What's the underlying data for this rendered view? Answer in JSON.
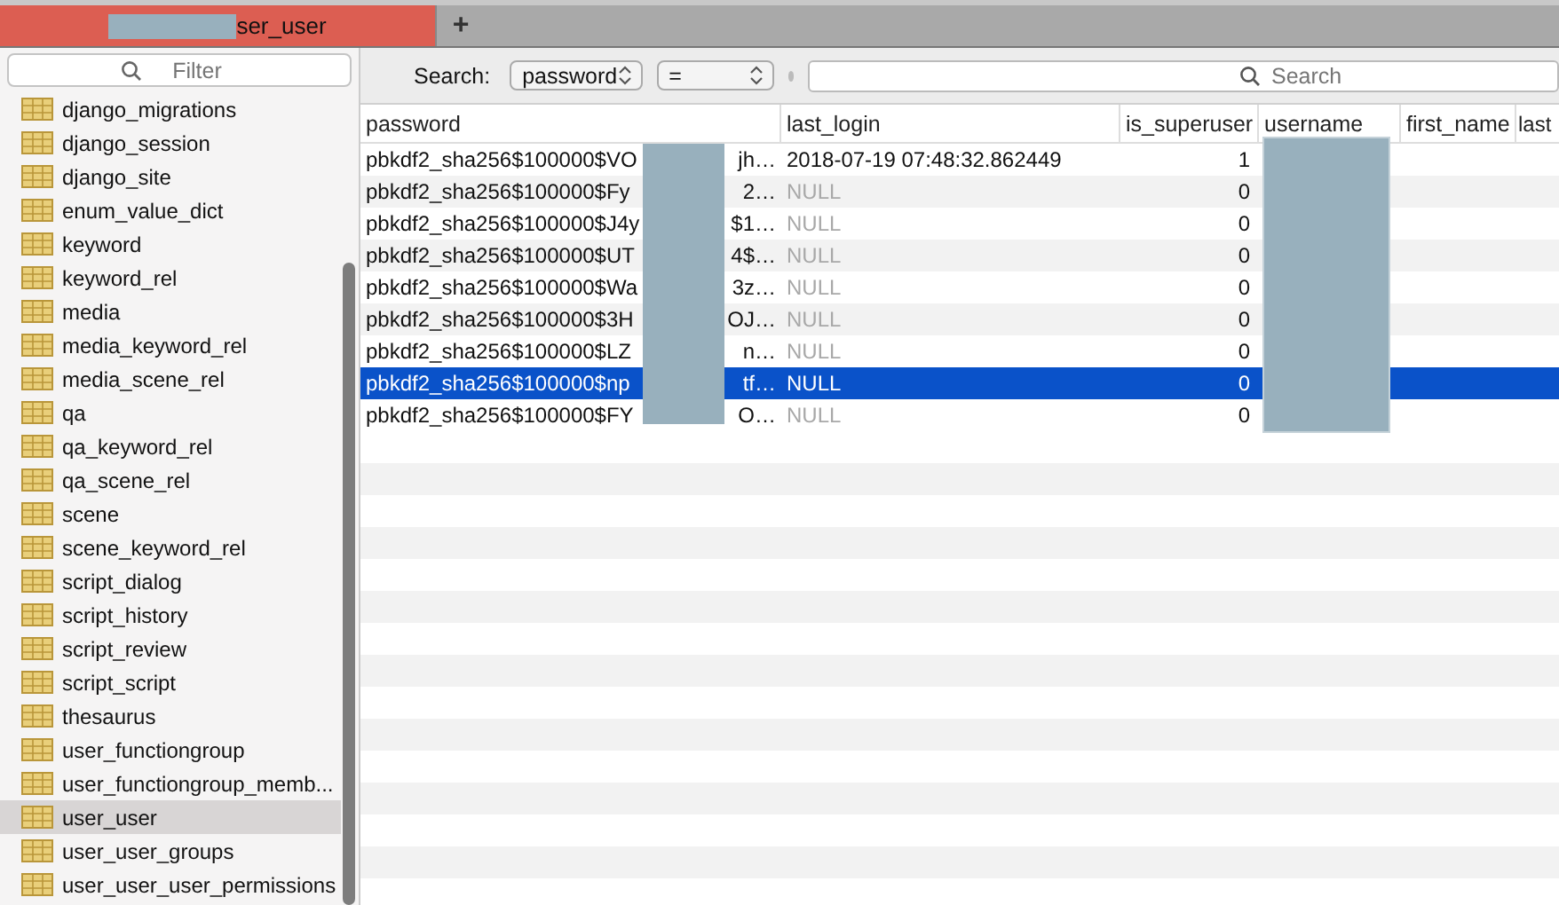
{
  "tabs": [
    {
      "title": "ser_user",
      "selected": true,
      "redacted": true
    }
  ],
  "new_tab_button": "+",
  "sidebar": {
    "filter_placeholder": "Filter",
    "items": [
      {
        "label": "django_migrations",
        "selected": false
      },
      {
        "label": "django_session",
        "selected": false
      },
      {
        "label": "django_site",
        "selected": false
      },
      {
        "label": "enum_value_dict",
        "selected": false
      },
      {
        "label": "keyword",
        "selected": false
      },
      {
        "label": "keyword_rel",
        "selected": false
      },
      {
        "label": "media",
        "selected": false
      },
      {
        "label": "media_keyword_rel",
        "selected": false
      },
      {
        "label": "media_scene_rel",
        "selected": false
      },
      {
        "label": "qa",
        "selected": false
      },
      {
        "label": "qa_keyword_rel",
        "selected": false
      },
      {
        "label": "qa_scene_rel",
        "selected": false
      },
      {
        "label": "scene",
        "selected": false
      },
      {
        "label": "scene_keyword_rel",
        "selected": false
      },
      {
        "label": "script_dialog",
        "selected": false
      },
      {
        "label": "script_history",
        "selected": false
      },
      {
        "label": "script_review",
        "selected": false
      },
      {
        "label": "script_script",
        "selected": false
      },
      {
        "label": "thesaurus",
        "selected": false
      },
      {
        "label": "user_functiongroup",
        "selected": false
      },
      {
        "label": "user_functiongroup_memb...",
        "selected": false
      },
      {
        "label": "user_user",
        "selected": true
      },
      {
        "label": "user_user_groups",
        "selected": false
      },
      {
        "label": "user_user_user_permissions",
        "selected": false
      }
    ]
  },
  "search_bar": {
    "label": "Search:",
    "field": "password",
    "operator": "=",
    "placeholder": "Search"
  },
  "table": {
    "columns": [
      "password",
      "last_login",
      "is_superuser",
      "username",
      "first_name",
      "last"
    ],
    "rows": [
      {
        "password_start": "pbkdf2_sha256$100000$VO",
        "password_end": "jh…",
        "last_login": "2018-07-19 07:48:32.862449",
        "last_login_null": false,
        "is_superuser": "1",
        "selected": false
      },
      {
        "password_start": "pbkdf2_sha256$100000$Fy",
        "password_end": "2…",
        "last_login": "NULL",
        "last_login_null": true,
        "is_superuser": "0",
        "selected": false
      },
      {
        "password_start": "pbkdf2_sha256$100000$J4y",
        "password_end": "$1…",
        "last_login": "NULL",
        "last_login_null": true,
        "is_superuser": "0",
        "selected": false
      },
      {
        "password_start": "pbkdf2_sha256$100000$UT",
        "password_end": "4$…",
        "last_login": "NULL",
        "last_login_null": true,
        "is_superuser": "0",
        "selected": false
      },
      {
        "password_start": "pbkdf2_sha256$100000$Wa",
        "password_end": "3z…",
        "last_login": "NULL",
        "last_login_null": true,
        "is_superuser": "0",
        "selected": false
      },
      {
        "password_start": "pbkdf2_sha256$100000$3H",
        "password_end": "OJ…",
        "last_login": "NULL",
        "last_login_null": true,
        "is_superuser": "0",
        "selected": false
      },
      {
        "password_start": "pbkdf2_sha256$100000$LZ",
        "password_end": "n…",
        "last_login": "NULL",
        "last_login_null": true,
        "is_superuser": "0",
        "selected": false
      },
      {
        "password_start": "pbkdf2_sha256$100000$np",
        "password_end": "tf…",
        "last_login": "NULL",
        "last_login_null": true,
        "is_superuser": "0",
        "selected": true
      },
      {
        "password_start": "pbkdf2_sha256$100000$FY",
        "password_end": "O…",
        "last_login": "NULL",
        "last_login_null": true,
        "is_superuser": "0",
        "selected": false
      }
    ]
  }
}
